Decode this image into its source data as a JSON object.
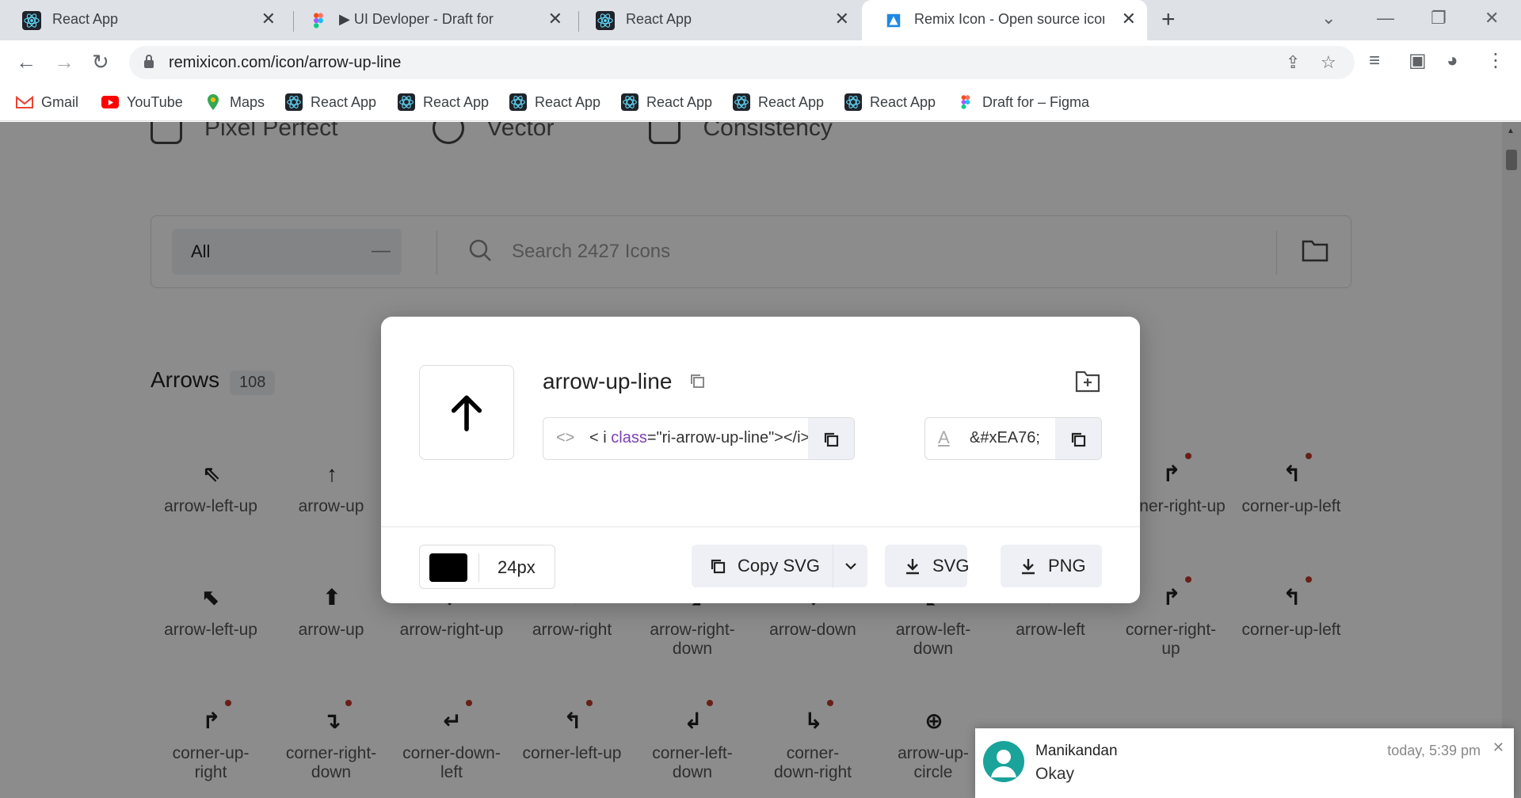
{
  "browser": {
    "tabs": [
      {
        "title": "React App",
        "icon": "react-icon"
      },
      {
        "title": "▶ UI Devloper - Draft for",
        "icon": "figma-icon"
      },
      {
        "title": "React App",
        "icon": "react-icon"
      },
      {
        "title": "Remix Icon - Open source icon lil",
        "icon": "remix-icon"
      }
    ],
    "url": "remixicon.com/icon/arrow-up-line",
    "bookmarks": [
      {
        "label": "Gmail",
        "icon": "gmail-icon"
      },
      {
        "label": "YouTube",
        "icon": "youtube-icon"
      },
      {
        "label": "Maps",
        "icon": "maps-icon"
      },
      {
        "label": "React App",
        "icon": "react-icon"
      },
      {
        "label": "React App",
        "icon": "react-icon"
      },
      {
        "label": "React App",
        "icon": "react-icon"
      },
      {
        "label": "React App",
        "icon": "react-icon"
      },
      {
        "label": "React App",
        "icon": "react-icon"
      },
      {
        "label": "React App",
        "icon": "react-icon"
      },
      {
        "label": "Draft for – Figma",
        "icon": "figma-icon"
      }
    ]
  },
  "page": {
    "features": [
      "Pixel Perfect",
      "Vector",
      "Consistency"
    ],
    "search": {
      "category": "All",
      "placeholder": "Search 2427 Icons"
    },
    "section": {
      "title": "Arrows",
      "count": "108"
    },
    "icons": [
      {
        "name": "arrow-left-up",
        "glyph": "⇖",
        "new": false
      },
      {
        "name": "arrow-up",
        "glyph": "↑",
        "new": false
      },
      {
        "name": "corner-right-up",
        "glyph": "↱",
        "new": true
      },
      {
        "name": "corner-up-left",
        "glyph": "↰",
        "new": true
      },
      {
        "name": "arrow-left-up",
        "glyph": "⬉",
        "new": false
      },
      {
        "name": "arrow-up",
        "glyph": "⬆",
        "new": false
      },
      {
        "name": "arrow-right-up",
        "glyph": "⬈",
        "new": false
      },
      {
        "name": "arrow-right",
        "glyph": "➡",
        "new": false
      },
      {
        "name": "arrow-right-down",
        "glyph": "⬊",
        "new": false
      },
      {
        "name": "arrow-down",
        "glyph": "⬇",
        "new": false
      },
      {
        "name": "arrow-left-down",
        "glyph": "⬋",
        "new": false
      },
      {
        "name": "arrow-left",
        "glyph": "⬅",
        "new": false
      },
      {
        "name": "corner-right-up",
        "glyph": "↱",
        "new": true
      },
      {
        "name": "corner-up-left",
        "glyph": "↰",
        "new": true
      },
      {
        "name": "corner-up-right",
        "glyph": "↱",
        "new": true
      },
      {
        "name": "corner-right-down",
        "glyph": "↴",
        "new": true
      },
      {
        "name": "corner-down-left",
        "glyph": "↵",
        "new": true
      },
      {
        "name": "corner-left-up",
        "glyph": "↰",
        "new": true
      },
      {
        "name": "corner-left-down",
        "glyph": "↲",
        "new": true
      },
      {
        "name": "corner-down-right",
        "glyph": "↳",
        "new": true
      },
      {
        "name": "arrow-up-circle",
        "glyph": "⊕",
        "new": false
      }
    ]
  },
  "modal": {
    "icon_name": "arrow-up-line",
    "code_prefix": "< i ",
    "code_attr": "class",
    "code_value": "=\"ri-arrow-up-line\"></i>",
    "unicode": "&#xEA76;",
    "size": "24px",
    "color": "#000000",
    "copy_svg": "Copy SVG",
    "download_svg": "SVG",
    "download_png": "PNG"
  },
  "notification": {
    "sender": "Manikandan",
    "message": "Okay",
    "time": "today, 5:39 pm"
  }
}
